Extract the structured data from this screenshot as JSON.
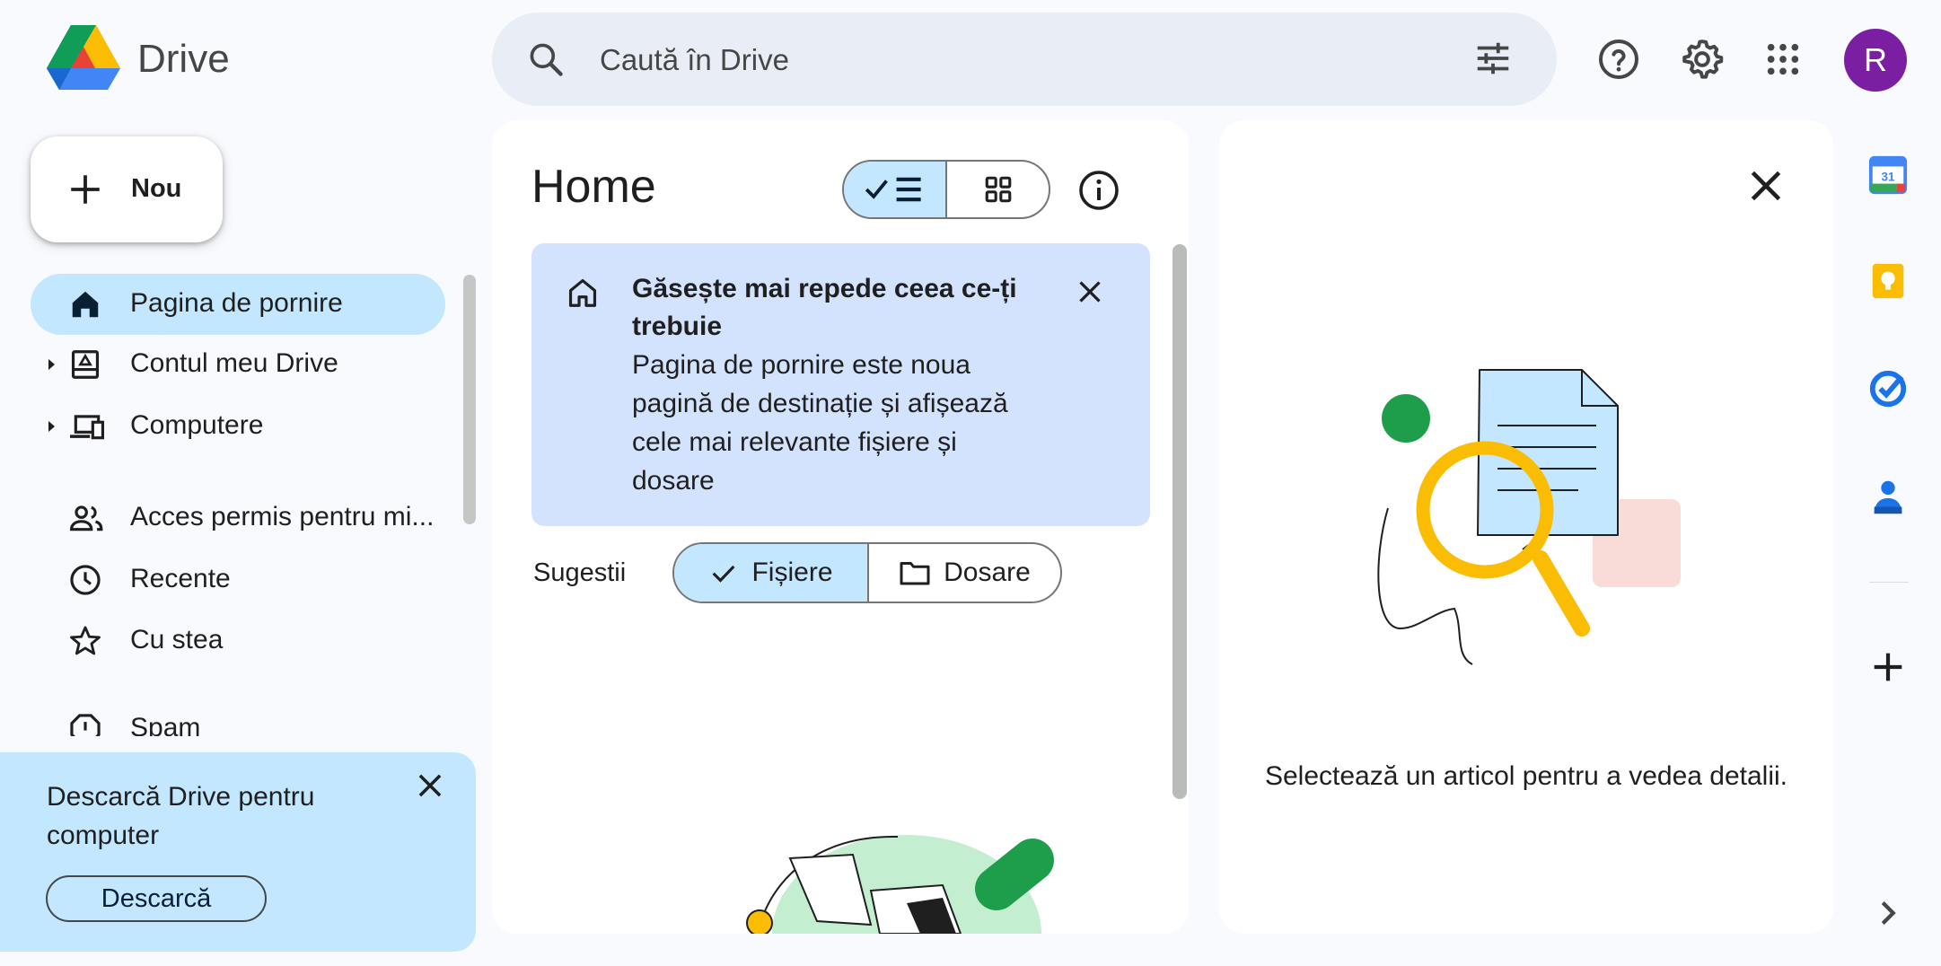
{
  "app": {
    "title": "Drive",
    "logo_icon": "google-drive-logo"
  },
  "search": {
    "placeholder": "Caută în Drive",
    "icon": "search-icon",
    "filter_icon": "tune-icon"
  },
  "header": {
    "help_icon": "help-icon",
    "settings_icon": "gear-icon",
    "apps_icon": "apps-grid-icon",
    "avatar_letter": "R",
    "avatar_color": "#7b1fa2"
  },
  "new_button": {
    "label": "Nou"
  },
  "sidebar": {
    "items": [
      {
        "label": "Pagina de pornire",
        "icon": "home-icon",
        "active": true
      },
      {
        "label": "Contul meu Drive",
        "icon": "my-drive-icon",
        "expandable": true
      },
      {
        "label": "Computere",
        "icon": "computers-icon",
        "expandable": true
      },
      {
        "label": "Acces permis pentru mi...",
        "icon": "shared-icon"
      },
      {
        "label": "Recente",
        "icon": "clock-icon"
      },
      {
        "label": "Cu stea",
        "icon": "star-icon"
      },
      {
        "label": "Spam",
        "icon": "spam-icon"
      }
    ]
  },
  "download_panel": {
    "message": "Descarcă Drive pentru computer",
    "button_label": "Descarcă"
  },
  "main": {
    "title": "Home",
    "view_toggle": {
      "list_selected": true
    },
    "banner": {
      "title": "Găsește mai repede ceea ce-ți trebuie",
      "description": "Pagina de pornire este noua pagină de destinație și afișează cele mai relevante fișiere și dosare"
    },
    "suggestions": {
      "label": "Sugestii",
      "chips": [
        {
          "label": "Fișiere",
          "selected": true
        },
        {
          "label": "Dosare",
          "selected": false
        }
      ]
    }
  },
  "details": {
    "empty_text": "Selectează un articol pentru a vedea detalii."
  },
  "side_panel": {
    "apps": [
      "calendar-icon",
      "keep-icon",
      "tasks-icon",
      "contacts-icon"
    ],
    "add_icon": "plus-icon",
    "expand_icon": "chevron-right-icon"
  },
  "colors": {
    "accent": "#c2e7ff",
    "banner": "#d3e3fd",
    "background": "#f8fafd"
  }
}
